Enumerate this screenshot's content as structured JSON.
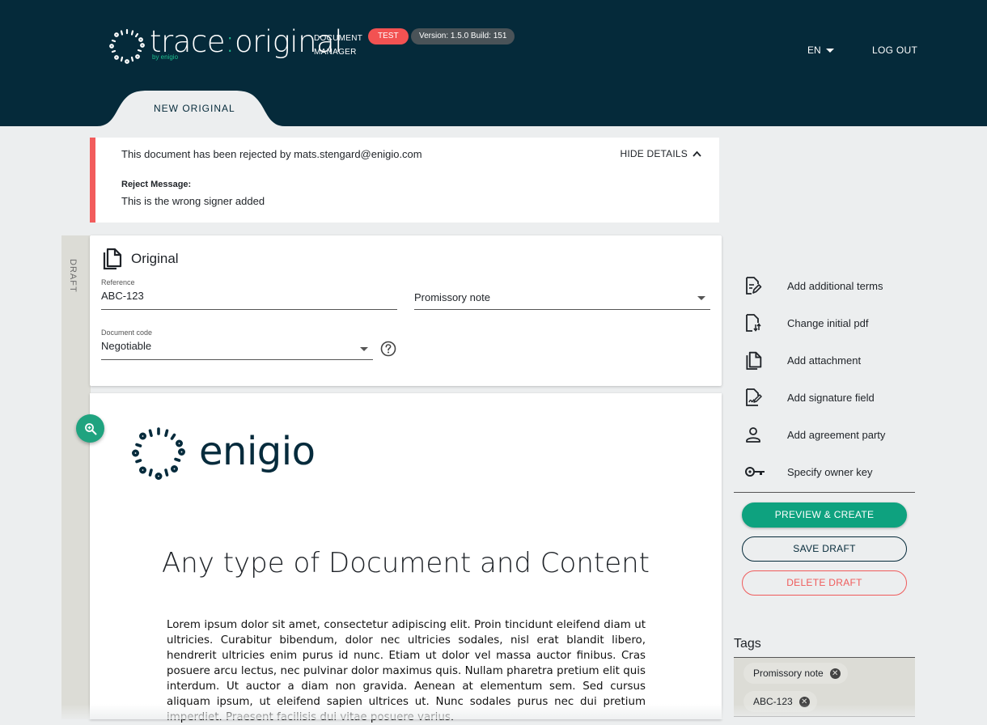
{
  "header": {
    "brand_left": "trace",
    "brand_colon": ":",
    "brand_right": "original",
    "brand_sub": "by enigio",
    "product_line1": "DOCUMENT",
    "product_line2": "MANAGER",
    "env_badge": "TEST",
    "version": "Version: 1.5.0 Build: 151",
    "language": "EN",
    "logout": "LOG OUT",
    "active_tab": "NEW ORIGINAL"
  },
  "rejection": {
    "message": "This document has been rejected by mats.stengard@enigio.com",
    "toggle": "HIDE DETAILS",
    "reason_label": "Reject Message:",
    "reason": "This is the wrong signer added"
  },
  "status_strip": "DRAFT",
  "form": {
    "title": "Original",
    "reference_label": "Reference",
    "reference_value": "ABC-123",
    "type_value": "Promissory note",
    "code_label": "Document code",
    "code_value": "Negotiable"
  },
  "preview": {
    "logo_text": "enigio",
    "heading": "Any type of Document and Content",
    "body": "Lorem ipsum dolor sit amet, consectetur adipiscing elit. Proin tincidunt eleifend diam ut ultricies. Curabitur bibendum, dolor nec ultricies sodales, nisl erat blandit libero, hendrerit ultricies enim purus id nunc. Etiam ut dolor vel massa auctor finibus. Cras posuere arcu lectus, nec pulvinar dolor maximus quis. Nullam pharetra pretium elit quis interdum. Ut auctor a diam non gravida. Aenean at elementum sem. Sed cursus aliquam ipsum, ut eleifend sapien ultrices ut. Nunc sodales purus nec dui pretium imperdiet. Praesent facilisis dui vitae posuere varius."
  },
  "actions": [
    {
      "label": "Add additional terms",
      "icon": "document-edit-icon"
    },
    {
      "label": "Change initial pdf",
      "icon": "file-swap-icon"
    },
    {
      "label": "Add attachment",
      "icon": "copy-document-icon"
    },
    {
      "label": "Add signature field",
      "icon": "signature-icon"
    },
    {
      "label": "Add agreement party",
      "icon": "person-icon"
    },
    {
      "label": "Specify owner key",
      "icon": "key-icon"
    }
  ],
  "buttons": {
    "preview_create": "PREVIEW & CREATE",
    "save_draft": "SAVE DRAFT",
    "delete_draft": "DELETE DRAFT"
  },
  "tags": {
    "title": "Tags",
    "items": [
      "Promissory note",
      "ABC-123"
    ]
  },
  "colors": {
    "header_bg": "#052a3a",
    "accent_green": "#0ea27f",
    "danger_red": "#ef5b5b"
  }
}
